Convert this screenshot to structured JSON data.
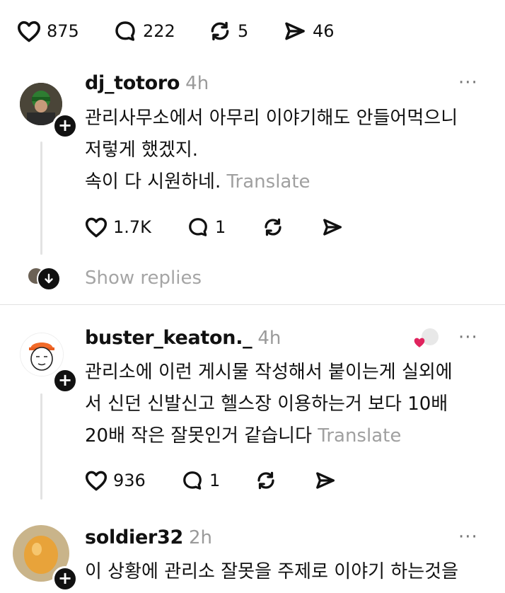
{
  "top_actions": {
    "likes": "875",
    "comments": "222",
    "reposts": "5",
    "shares": "46"
  },
  "comments": [
    {
      "username": "dj_totoro",
      "time": "4h",
      "lines": [
        "관리사무소에서 아무리 이야기해도 안들어먹으니",
        "저렇게 했겠지.",
        "속이 다 시원하네."
      ],
      "translate_label": "Translate",
      "likes": "1.7K",
      "replies": "1",
      "show_replies_label": "Show replies",
      "more_label": "···"
    },
    {
      "username": "buster_keaton._",
      "time": "4h",
      "lines": [
        "관리소에 이런 게시물 작성해서 붙이는게 실외에",
        "서 신던 신발신고 헬스장 이용하는거 보다 10배",
        "20배 작은 잘못인거 같습니다"
      ],
      "translate_label": "Translate",
      "likes": "936",
      "replies": "1",
      "more_label": "···"
    },
    {
      "username": "soldier32",
      "time": "2h",
      "lines": [
        "이 상황에 관리소 잘못을 주제로 이야기 하는것을"
      ],
      "more_label": "···"
    }
  ],
  "colors": {
    "text": "#111111",
    "muted": "#9a9a9a",
    "heart_red": "#e0245e"
  }
}
